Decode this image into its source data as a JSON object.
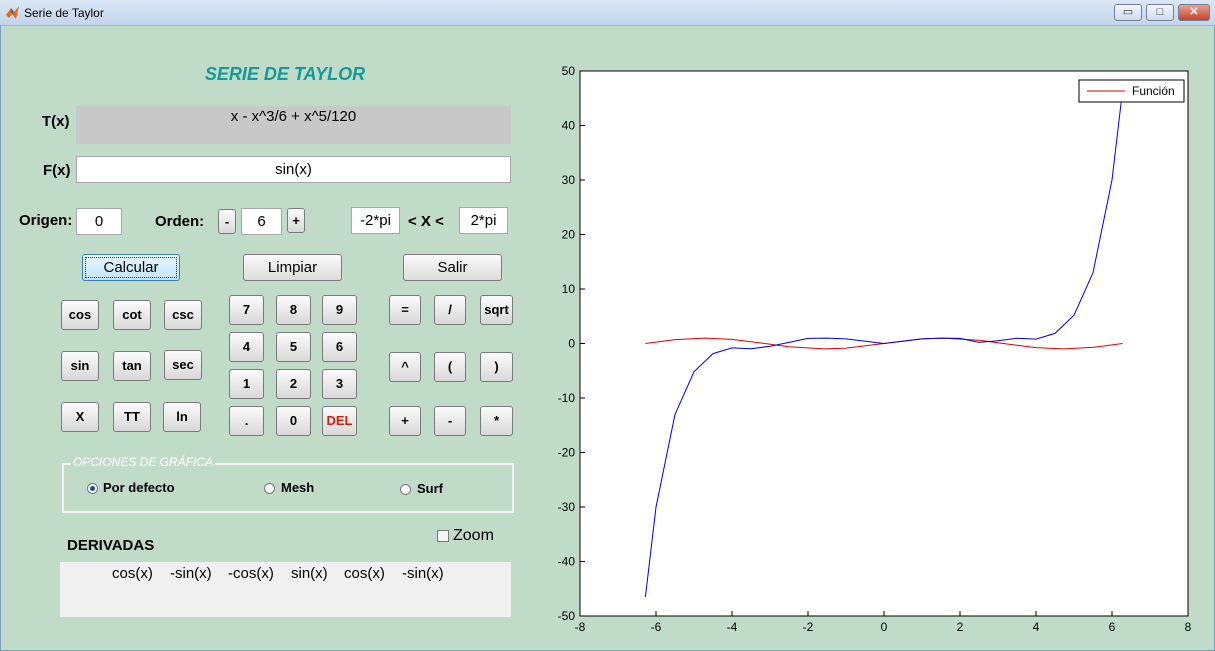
{
  "window": {
    "title": "Serie de Taylor",
    "min_label": "▭",
    "max_label": "□",
    "close_label": "✕"
  },
  "header": {
    "title": "SERIE DE TAYLOR"
  },
  "taylor": {
    "label": "T(x)",
    "value": "x - x^3/6 + x^5/120"
  },
  "function": {
    "label": "F(x)",
    "value": "sin(x)"
  },
  "origin": {
    "label": "Origen:",
    "value": "0"
  },
  "order": {
    "label": "Orden:",
    "minus": "-",
    "value": "6",
    "plus": "+"
  },
  "range": {
    "min": "-2*pi",
    "sep": "< X <",
    "max": "2*pi"
  },
  "actions": {
    "calc": "Calcular",
    "clear": "Limpiar",
    "exit": "Salir"
  },
  "func_keys": [
    "cos",
    "cot",
    "csc",
    "sin",
    "tan",
    "sec",
    "X",
    "TT",
    "ln"
  ],
  "num_keys": [
    "7",
    "8",
    "9",
    "4",
    "5",
    "6",
    "1",
    "2",
    "3",
    ".",
    "0",
    "DEL"
  ],
  "op_keys": [
    "=",
    "/",
    "sqrt",
    "^",
    "(",
    ")",
    "+",
    "-",
    "*"
  ],
  "graph_options": {
    "legend": "OPCIONES DE GRÁFICA",
    "default": "Por defecto",
    "mesh": "Mesh",
    "surf": "Surf",
    "selected": "default"
  },
  "zoom": {
    "label": "Zoom",
    "checked": false
  },
  "derivatives": {
    "title": "DERIVADAS",
    "items": [
      "cos(x)",
      "-sin(x)",
      "-cos(x)",
      "sin(x)",
      "cos(x)",
      "-sin(x)"
    ]
  },
  "colors": {
    "title_teal": "#159a97",
    "del_red": "#d02010",
    "function_line": "#e00000",
    "taylor_line": "#0000d8"
  },
  "chart_data": {
    "type": "line",
    "xlim": [
      -8,
      8
    ],
    "ylim": [
      -50,
      50
    ],
    "xticks": [
      -8,
      -6,
      -4,
      -2,
      0,
      2,
      4,
      6,
      8
    ],
    "yticks": [
      -50,
      -40,
      -30,
      -20,
      -10,
      0,
      10,
      20,
      30,
      40,
      50
    ],
    "legend": {
      "position": "top-right",
      "entries": [
        "Función"
      ]
    },
    "grid": false,
    "series": [
      {
        "name": "Función",
        "color": "#e00000",
        "x": [
          -6.28,
          -5.5,
          -4.71,
          -4,
          -3.14,
          -2.5,
          -1.57,
          -1,
          0,
          1,
          1.57,
          2.5,
          3.14,
          4,
          4.71,
          5.5,
          6.28
        ],
        "y": [
          0,
          0.71,
          1,
          0.76,
          0,
          -0.6,
          -1,
          -0.84,
          0,
          0.84,
          1,
          0.6,
          0,
          -0.76,
          -1,
          -0.71,
          0
        ]
      },
      {
        "color": "#0000d8",
        "x": [
          -6.28,
          -6,
          -5.5,
          -5,
          -4.5,
          -4,
          -3.5,
          -3,
          -2.5,
          -2,
          -1.5,
          -1,
          0,
          1,
          1.5,
          2,
          2.5,
          3,
          3.5,
          4,
          4.5,
          5,
          5.5,
          6,
          6.28
        ],
        "y": [
          -46.5,
          -30,
          -13,
          -5.2,
          -1.86,
          -0.8,
          -0.95,
          -0.52,
          0.21,
          0.93,
          1.0,
          0.84,
          0,
          0.84,
          1.0,
          0.93,
          0.21,
          0.52,
          0.95,
          0.8,
          1.86,
          5.2,
          13,
          30,
          46.5
        ]
      }
    ]
  }
}
